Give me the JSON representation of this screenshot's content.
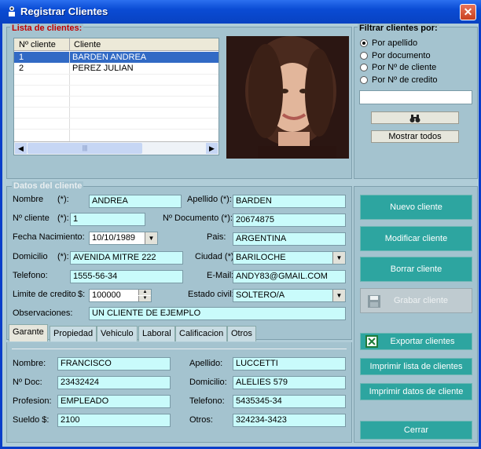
{
  "window": {
    "title": "Registrar Clientes",
    "close_glyph": "✕"
  },
  "list_panel": {
    "legend": "Lista de clientes:",
    "columns": [
      "Nº cliente",
      "Cliente"
    ],
    "rows": [
      {
        "num": "1",
        "name": "BARDEN ANDREA"
      },
      {
        "num": "2",
        "name": "PEREZ JULIAN"
      }
    ],
    "scroll_thumb": "|||"
  },
  "filter": {
    "legend": "Filtrar clientes por:",
    "options": [
      "Por apellido",
      "Por documento",
      "Por Nº de cliente",
      "Por Nº de credito"
    ],
    "search_value": "",
    "show_all": "Mostrar todos",
    "search_icon": "binoculars-icon"
  },
  "datos": {
    "legend": "Datos del cliente",
    "nombre_label": "Nombre",
    "req1": "(*):",
    "nombre": "ANDREA",
    "apellido_label": "Apellido (*):",
    "apellido": "BARDEN",
    "ncliente_label": "Nº cliente",
    "req2": "(*):",
    "ncliente": "1",
    "ndoc_label": "Nº Documento (*):",
    "ndoc": "20674875",
    "fecha_label": "Fecha Nacimiento:",
    "fecha": "10/10/1989",
    "pais_label": "Pais:",
    "pais": "ARGENTINA",
    "domicilio_label": "Domicilio",
    "req3": "(*):",
    "domicilio": "AVENIDA MITRE 222",
    "ciudad_label": "Ciudad (*):",
    "ciudad": "BARILOCHE",
    "telefono_label": "Telefono:",
    "telefono": "1555-56-34",
    "email_label": "E-Mail:",
    "email": "ANDY83@GMAIL.COM",
    "limite_label": "Limite de credito",
    "dollar": "$:",
    "limite": "100000",
    "estado_label": "Estado civil:",
    "estado": "SOLTERO/A",
    "obs_label": "Observaciones:",
    "obs": "UN CLIENTE DE EJEMPLO"
  },
  "tabs": [
    "Garante",
    "Propiedad",
    "Vehiculo",
    "Laboral",
    "Calificacion",
    "Otros"
  ],
  "garante": {
    "nombre_label": "Nombre:",
    "nombre": "FRANCISCO",
    "apellido_label": "Apellido:",
    "apellido": "LUCCETTI",
    "doc_label": "Nº Doc:",
    "doc": "23432424",
    "domicilio_label": "Domicilio:",
    "domicilio": "ALELIES 579",
    "profesion_label": "Profesion:",
    "profesion": "EMPLEADO",
    "telefono_label": "Telefono:",
    "telefono": "5435345-34",
    "sueldo_label": "Sueldo $:",
    "sueldo": "2100",
    "otros_label": "Otros:",
    "otros": "324234-3423"
  },
  "actions": {
    "nuevo": "Nuevo cliente",
    "modificar": "Modificar cliente",
    "borrar": "Borrar cliente",
    "grabar": "Grabar cliente",
    "exportar": "Exportar clientes",
    "imprimir_lista": "Imprimir lista de clientes",
    "imprimir_datos": "Imprimir datos de cliente",
    "cerrar": "Cerrar"
  },
  "colors": {
    "accent": "#2DA5A0",
    "field": "#C9FBFB",
    "panel": "#A4C3CF",
    "title": "#0A4BD4"
  }
}
